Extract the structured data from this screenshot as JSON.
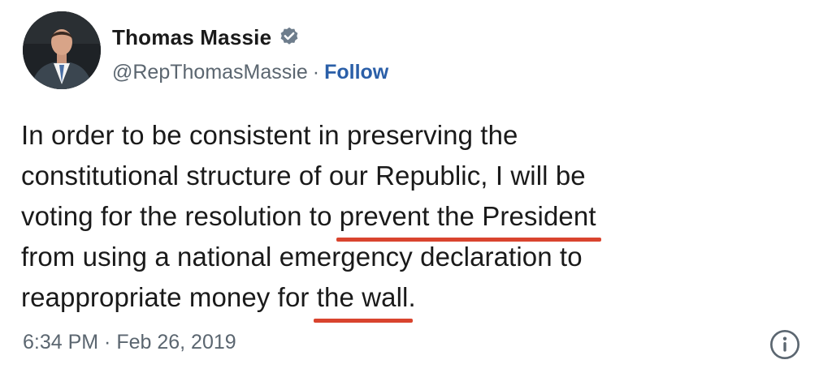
{
  "author": {
    "display_name": "Thomas Massie",
    "handle": "@RepThomasMassie",
    "separator": "·",
    "follow_label": "Follow",
    "avatar_icon": "profile-photo",
    "verified_icon": "verified-badge-icon"
  },
  "tweet": {
    "lines": [
      {
        "before": "In order to be consistent in preserving the",
        "highlight": "",
        "after": ""
      },
      {
        "before": "constitutional structure of our Republic, I will be",
        "highlight": "",
        "after": ""
      },
      {
        "before": "voting for the resolution to ",
        "highlight": "prevent the President",
        "after": ""
      },
      {
        "before": "from using a national emergency declaration to",
        "highlight": "",
        "after": ""
      },
      {
        "before": "reappropriate money for ",
        "highlight": "the wall",
        "after": "."
      }
    ],
    "timestamp": "6:34 PM · Feb 26, 2019",
    "info_icon": "info-icon"
  },
  "colors": {
    "follow": "#2b5fa8",
    "underline": "#d9442e",
    "verified_badge": "#6e7d8c",
    "muted_text": "#5b6670"
  }
}
